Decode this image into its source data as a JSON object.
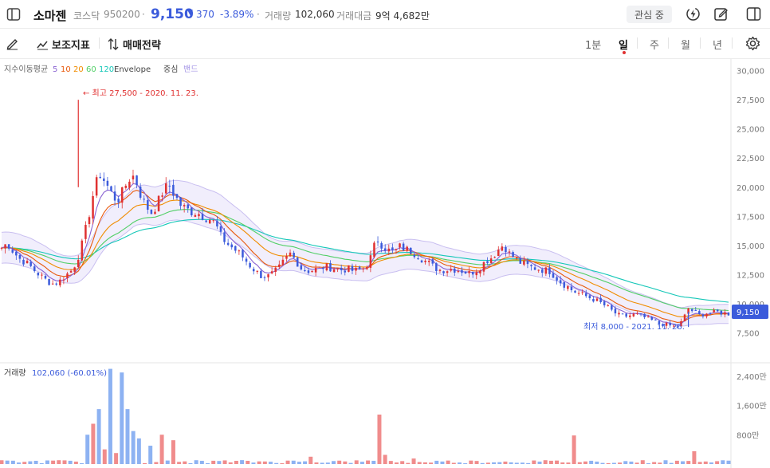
{
  "header": {
    "stock_name": "소마젠",
    "market": "코스닥",
    "code": "950200",
    "separator": "·",
    "price": "9,150",
    "change_arrow": "▼",
    "change": "370",
    "change_pct": "-3.89%",
    "volume_label": "거래량",
    "volume_value": "102,060",
    "amount_label": "거래대금",
    "amount_value": "9억 4,682만",
    "watch_button": "관심 중",
    "icons": [
      "sidebar-toggle-icon",
      "lightning-icon",
      "edit-icon",
      "panel-icon"
    ]
  },
  "toolbar": {
    "draw_icon": "pen-icon",
    "indicators_label": "보조지표",
    "strategy_label": "매매전략",
    "periods": [
      "1분",
      "일",
      "주",
      "월",
      "년"
    ],
    "active_period": "일",
    "settings_icon": "gear-icon"
  },
  "legend": {
    "ma_label": "지수이동평균",
    "ma_periods": [
      "5",
      "10",
      "20",
      "60",
      "120"
    ],
    "ma_colors": [
      "#8a63d2",
      "#e8590c",
      "#f08c00",
      "#51cf66",
      "#15c7b8"
    ],
    "envelope_label": "Envelope",
    "envelope_center": "중심",
    "envelope_band": "밴드"
  },
  "colors": {
    "up": "#e03131",
    "down": "#3b5bdb",
    "band_fill": "#eeeafb",
    "band_line": "#c9bff0"
  },
  "chart_data": [
    {
      "type": "candlestick",
      "title": "",
      "y_ticks": [
        "30,000",
        "27,500",
        "25,000",
        "22,500",
        "20,000",
        "17,500",
        "15,000",
        "12,500",
        "10,000",
        "7,500"
      ],
      "ylim": [
        5000,
        31000
      ],
      "current_price_label": "9,150",
      "current_price": 9150,
      "annotations": {
        "high": "← 최고 27,500 - 2020. 11. 23.",
        "low": "최저 8,000 - 2021. 11. 26."
      },
      "high_value": 27500,
      "low_value": 8000,
      "close_path": [
        14800,
        15200,
        14500,
        13900,
        13600,
        13200,
        12700,
        12300,
        11900,
        11700,
        11900,
        12400,
        12800,
        13600,
        15200,
        17300,
        19700,
        21200,
        20400,
        19500,
        18800,
        19600,
        20700,
        21000,
        19500,
        18400,
        17800,
        18600,
        19700,
        20200,
        19300,
        18500,
        18100,
        17900,
        17800,
        17500,
        17300,
        16900,
        15800,
        15200,
        14800,
        14400,
        13900,
        13300,
        12800,
        12400,
        12300,
        12600,
        13000,
        13700,
        14300,
        13700,
        13000,
        12800,
        12900,
        13000,
        13200,
        13100,
        13000,
        12900,
        13000,
        12800,
        12900,
        13100,
        14000,
        15600,
        15000,
        14600,
        14400,
        14900,
        14700,
        14500,
        14200,
        13800,
        13500,
        13100,
        12900,
        12900,
        13000,
        12900,
        12800,
        12600,
        12800,
        13200,
        13700,
        14000,
        14600,
        15100,
        14300,
        13900,
        13500,
        13300,
        13100,
        13000,
        12900,
        12800,
        12300,
        11800,
        11500,
        11100,
        10900,
        10700,
        10500,
        10300,
        10000,
        9700,
        9300,
        9000,
        8900,
        9000,
        9100,
        8900,
        8700,
        8500,
        8300,
        8200,
        8100,
        8000,
        8500,
        9600,
        9300,
        9000,
        9200,
        9200,
        9300,
        9200,
        9150
      ],
      "ma_labels": [
        "5",
        "10",
        "20",
        "60",
        "120"
      ],
      "envelope": "center + band"
    },
    {
      "type": "bar",
      "title": "",
      "label": "거래량",
      "value_label": "102,060 (-60.01%)",
      "y_ticks": [
        "2,400만",
        "1,600만",
        "800만"
      ],
      "ylim": [
        0,
        2700
      ],
      "spikes_down": [
        [
          15,
          800
        ],
        [
          17,
          1500
        ],
        [
          19,
          2600
        ],
        [
          21,
          2500
        ],
        [
          22,
          1500
        ],
        [
          23,
          900
        ],
        [
          24,
          700
        ],
        [
          26,
          500
        ],
        [
          28,
          450
        ],
        [
          30,
          300
        ]
      ],
      "spikes_up": [
        [
          16,
          1100
        ],
        [
          18,
          400
        ],
        [
          20,
          300
        ],
        [
          28,
          800
        ],
        [
          30,
          650
        ],
        [
          66,
          1350
        ],
        [
          100,
          780
        ],
        [
          121,
          350
        ],
        [
          67,
          250
        ],
        [
          54,
          200
        ],
        [
          72,
          150
        ]
      ],
      "unit": "만"
    }
  ]
}
